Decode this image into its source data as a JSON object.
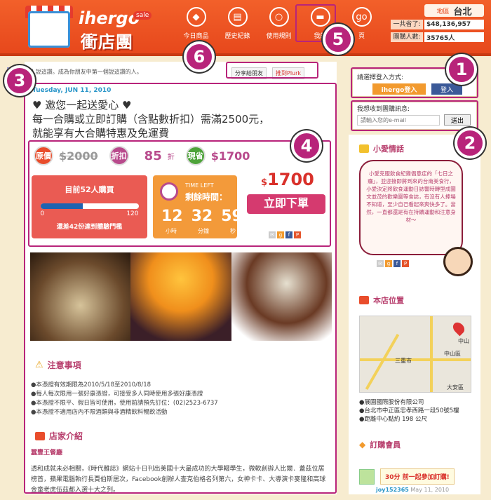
{
  "header": {
    "logo_en": "ihergo",
    "logo_sale": "sale",
    "logo_cn": "衝店團",
    "nav": [
      {
        "label": "今日商品",
        "icon": "tag-icon"
      },
      {
        "label": "歷史紀錄",
        "icon": "book-icon"
      },
      {
        "label": "使用規則",
        "icon": "search-icon"
      },
      {
        "label": "我的",
        "icon": "chat-icon"
      },
      {
        "label": "頁",
        "icon": "go-icon"
      }
    ],
    "region_label": "地區",
    "region_value": "台北",
    "stats": [
      {
        "label": "一共省了:",
        "value": "$48,136,957"
      },
      {
        "label": "團購人數:",
        "value": "35765人"
      }
    ]
  },
  "deal": {
    "like_label": "讚",
    "like_text": "94 人說這讚。成為你朋友中第一個說這讚的人。",
    "share_friends": "分享給朋友",
    "share_plurk": "推到Plurk",
    "date": "Tuesday, JUN 11, 2010",
    "title_line1": "♥ 邀您一起送愛心 ♥",
    "title_line2": "每一合購或立即訂購（含點數折扣）需滿2500元，",
    "title_line3": "就能享有大合購特惠及免運費",
    "orig_label": "原價",
    "orig_price": "$2000",
    "disc_label": "折扣",
    "disc_value": "85",
    "disc_unit": "折",
    "save_label": "現省",
    "save_value": "$1700",
    "buyers": "目前52人購買",
    "progress": 0.43,
    "bar_min": "0",
    "bar_max": "120",
    "need": "還差42份達到體驗門檻",
    "time_left": "TIME LEFT",
    "time_cn": "剩餘時間：",
    "hours": "12",
    "minutes": "32",
    "seconds": "59",
    "unit_h": "小時",
    "unit_m": "分鐘",
    "unit_s": "秒",
    "price_sym": "$",
    "price": "1700",
    "buy_label": "立即下單"
  },
  "notes": {
    "heading": "注意事項",
    "items": [
      "●本憑證有效期限為2010/5/18至2010/8/18",
      "●每人每次限用一張好康憑證，可接受多人同時使用多張好康憑證",
      "●本憑證不限平、假日皆可使用，使用前請預先訂位：(02)2523-6737",
      "●本憑證不適用店內不限酒類與非酒精飲料暢飲活動"
    ]
  },
  "shop": {
    "heading": "店家介紹",
    "name": "蠶豐王餐廳",
    "desc": "透和成就未必相關，《時代雜誌》網站十日刊出美國十大最成功的大學輟學生，微軟創辦人比爾．蓋茲位居榜首，蘋果電腦執行長賈伯斯居次，Facebook創辦人查克伯格名列第六，女神卡卡、大導演卡麥隆和高球金童老虎伍茲都入選十大之列。"
  },
  "sidebar": {
    "login_label": "請選擇登入方式:",
    "ihergo_login": "ihergo登入",
    "fb_login": "登入",
    "email_label": "我想收到團購訊息:",
    "email_placeholder": "請輸入您的e-mail",
    "email_submit": "送出",
    "story_heading": "小愛情話",
    "story_text": "小愛克服飲食紀錄倡意症的「七日之癮」，並迎接即將到來的台南美食行，小愛決定將飲食運動日誌響時轉型成圖文並茂的歡樂圖等食誌，有沒有人捧場不知道，至少自己看起來爽快多了。當然，一直都還是有在持續運動和注意身材～",
    "location_heading": "本店位置",
    "map_labels": [
      "中山",
      "中山區",
      "三重市",
      "大安區"
    ],
    "address": [
      "●展園國際股份有限公司",
      "●台北市中正區忠孝西路一段50號5樓",
      "●距離中心點約 198 公尺"
    ],
    "member_heading": "訂購會員",
    "member_msg": "30分 前一起參加訂購!",
    "member_user": "joy152365",
    "member_date": "May 11, 2010"
  },
  "callouts": [
    "1",
    "2",
    "3",
    "4",
    "5",
    "6"
  ],
  "colors": {
    "accent": "#b8247a",
    "header": "#e7481c",
    "price": "#d9302a"
  }
}
